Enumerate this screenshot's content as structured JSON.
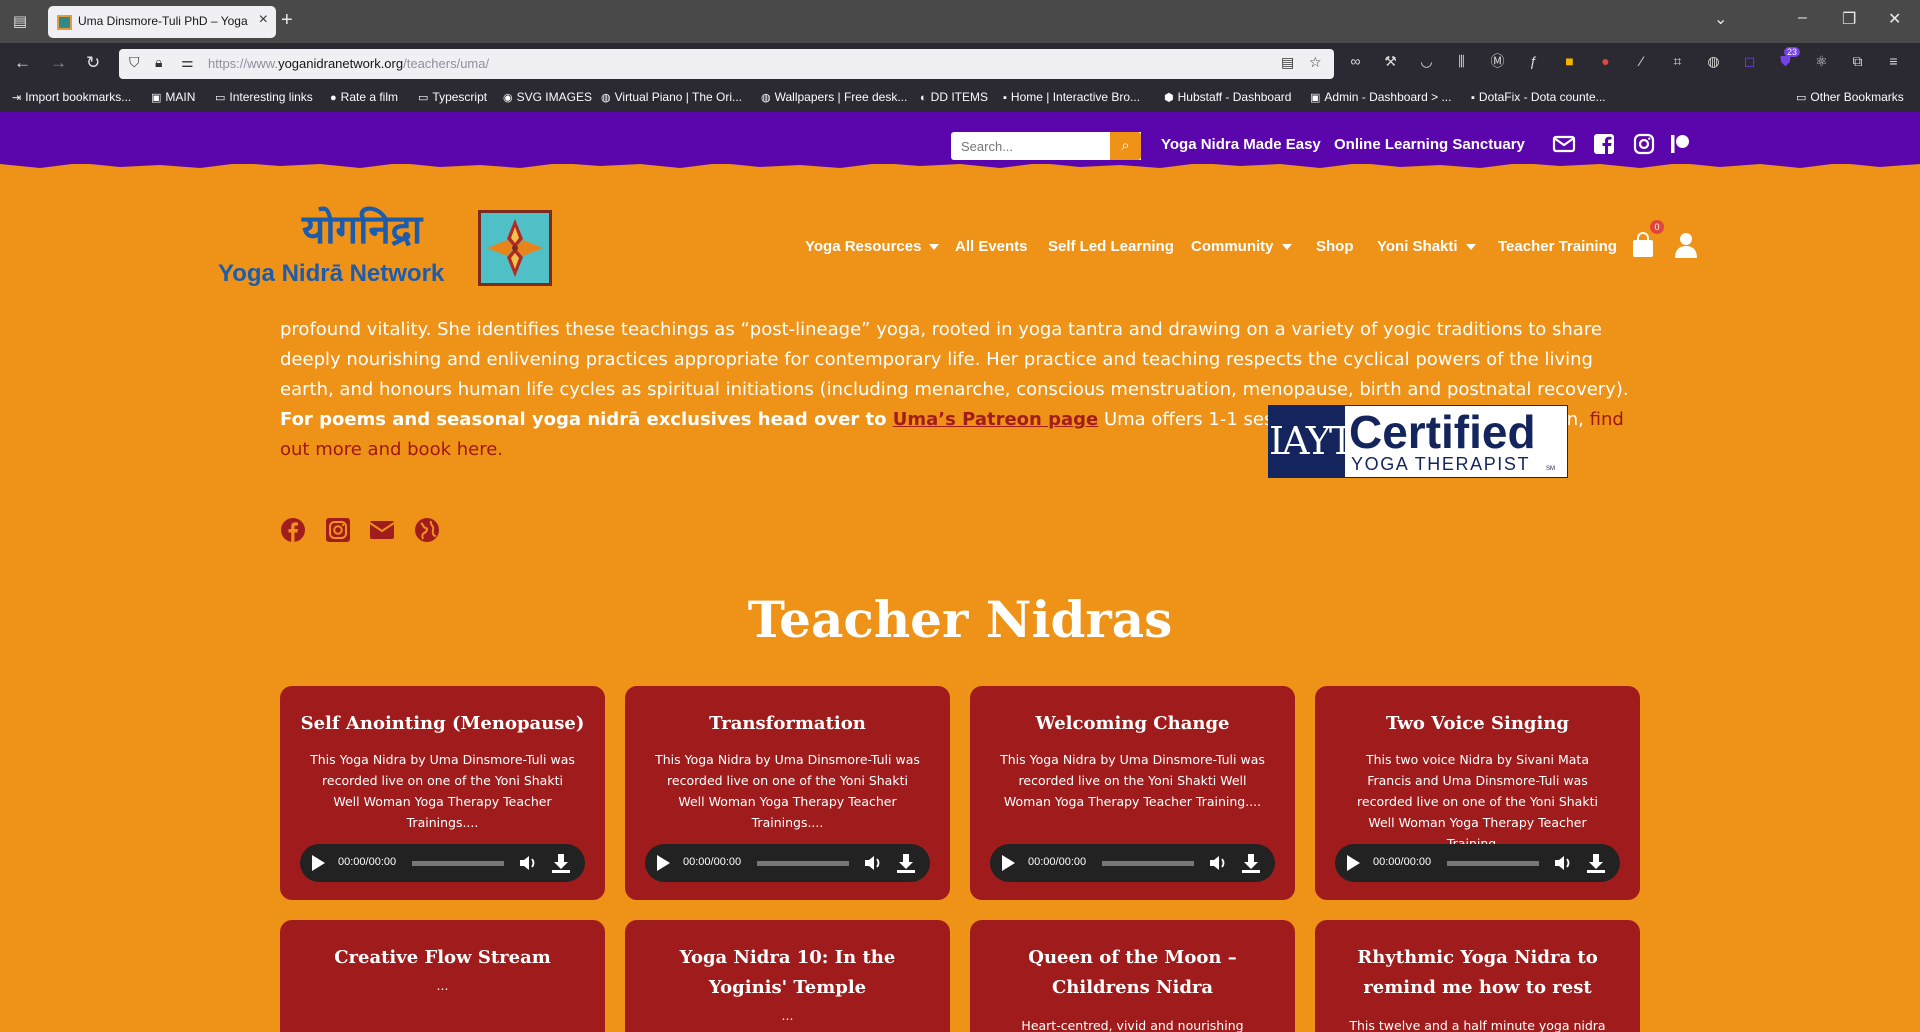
{
  "browser": {
    "tab_title": "Uma Dinsmore-Tuli PhD – Yoga Nidra Network",
    "url_host": "https://www.",
    "url_domain": "yoganidranetwork.org",
    "url_path": "/teachers/uma/",
    "extension_badge": "23",
    "bookmarks": [
      "Import bookmarks...",
      "MAIN",
      "Interesting links",
      "Rate a film",
      "Typescript",
      "SVG IMAGES",
      "Virtual Piano | The Ori...",
      "Wallpapers | Free desk...",
      "DD ITEMS",
      "Home | Interactive Bro...",
      "Hubstaff - Dashboard",
      "Admin - Dashboard > ...",
      "DotaFix - Dota counte...",
      "Other Bookmarks"
    ]
  },
  "site_top": {
    "search_placeholder": "Search...",
    "links": [
      "Yoga Nidra Made Easy",
      "Online Learning Sanctuary"
    ]
  },
  "header": {
    "logo_devanagari": "योगनिद्रा",
    "logo_name": "Yoga Nidrā Network",
    "menu": [
      "Yoga Resources",
      "All Events",
      "Self Led Learning",
      "Community",
      "Shop",
      "Yoni Shakti",
      "Teacher Training"
    ],
    "cart_count": "0"
  },
  "bio": {
    "text_1": "profound vitality. She identifies these teachings as “post-lineage” yoga, rooted in yoga tantra and drawing on a variety of yogic traditions to share deeply nourishing and enlivening practices appropriate for contemporary life. Her practice and teaching respects the cyclical powers of the living earth, and honours human life cycles as spiritual initiations (including menarche, conscious menstruation, menopause, birth and postnatal recovery). ",
    "bold_text": "For poems and seasonal yoga nidrā exclusives head over to ",
    "patreon_link": "Uma’s Patreon page",
    "text_2": " Uma offers 1-1 sessions both on zoom and in person, ",
    "book_link": "find out more and book here.",
    "badge_mark": "IAYT",
    "badge_certified": "Certified",
    "badge_subtitle": "YOGA THERAPIST",
    "badge_sm": "SM"
  },
  "section_title": "Teacher Nidras",
  "player_time": "00:00/00:00",
  "cards": [
    {
      "title": "Self Anointing (Menopause)",
      "desc": "This Yoga Nidra by  Uma Dinsmore-Tuli was recorded live on one of the Yoni Shakti Well Woman Yoga Therapy Teacher Trainings...."
    },
    {
      "title": "Transformation",
      "desc": "This Yoga Nidra by  Uma Dinsmore-Tuli was recorded live on one of the Yoni Shakti Well Woman Yoga Therapy Teacher Trainings...."
    },
    {
      "title": "Welcoming Change",
      "desc": "This Yoga Nidra by  Uma Dinsmore-Tuli was recorded live on the Yoni Shakti Well Woman Yoga Therapy Teacher Training...."
    },
    {
      "title": "Two Voice Singing",
      "desc": "This two voice Nidra by Sivani Mata Francis and Uma Dinsmore-Tuli was recorded live on one of the Yoni Shakti Well Woman Yoga Therapy Teacher Training..."
    },
    {
      "title": "Creative Flow Stream",
      "desc": "..."
    },
    {
      "title": "Yoga Nidra 10: In the Yoginis' Temple",
      "desc": "..."
    },
    {
      "title": "Queen of the Moon – Childrens Nidra",
      "desc": "Heart-centred, vivid and nourishing meditations"
    },
    {
      "title": "Rhythmic Yoga Nidra to remind me how to rest",
      "desc": "This twelve and a half minute yoga nidra practice"
    }
  ]
}
